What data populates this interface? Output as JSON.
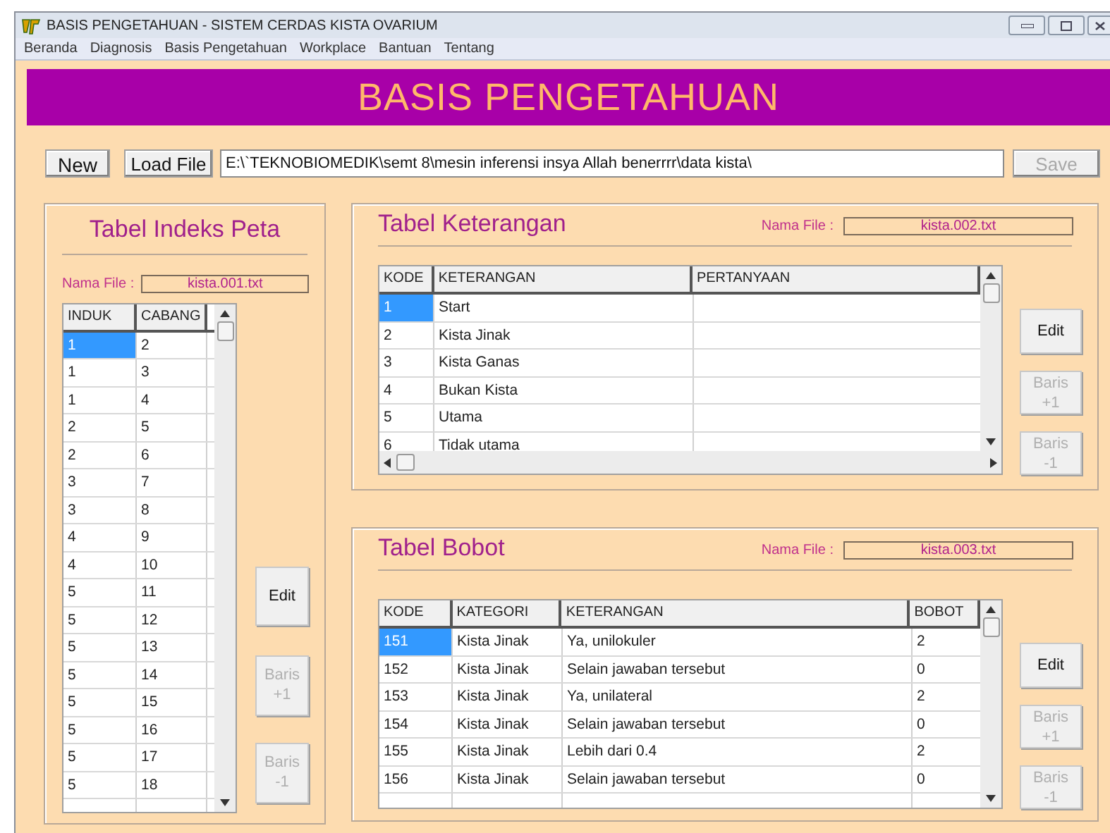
{
  "window": {
    "title": "BASIS PENGETAHUAN - SISTEM CERDAS KISTA OVARIUM"
  },
  "menu": [
    "Beranda",
    "Diagnosis",
    "Basis Pengetahuan",
    "Workplace",
    "Bantuan",
    "Tentang"
  ],
  "banner": "BASIS PENGETAHUAN",
  "toolbar": {
    "buttons": [
      {
        "label": "New",
        "disabled": false
      },
      {
        "label": "Load File",
        "disabled": false
      }
    ],
    "path": "E:\\`TEKNOBIOMEDIK\\semt 8\\mesin inferensi insya Allah benerrrr\\data kista\\",
    "save": {
      "label": "Save",
      "disabled": true
    }
  },
  "panels": [
    {
      "kind": "tall",
      "title": "Tabel Indeks Peta",
      "file_label": "Nama File :",
      "file": "kista.001.txt",
      "columns": [
        "INDUK",
        "CABANG"
      ],
      "rows": [
        {
          "cells": [
            "1",
            "2"
          ],
          "selected": true
        },
        {
          "cells": [
            "1",
            "3"
          ],
          "selected": false
        },
        {
          "cells": [
            "1",
            "4"
          ],
          "selected": false
        },
        {
          "cells": [
            "2",
            "5"
          ],
          "selected": false
        },
        {
          "cells": [
            "2",
            "6"
          ],
          "selected": false
        },
        {
          "cells": [
            "3",
            "7"
          ],
          "selected": false
        },
        {
          "cells": [
            "3",
            "8"
          ],
          "selected": false
        },
        {
          "cells": [
            "4",
            "9"
          ],
          "selected": false
        },
        {
          "cells": [
            "4",
            "10"
          ],
          "selected": false
        },
        {
          "cells": [
            "5",
            "11"
          ],
          "selected": false
        },
        {
          "cells": [
            "5",
            "12"
          ],
          "selected": false
        },
        {
          "cells": [
            "5",
            "13"
          ],
          "selected": false
        },
        {
          "cells": [
            "5",
            "14"
          ],
          "selected": false
        },
        {
          "cells": [
            "5",
            "15"
          ],
          "selected": false
        },
        {
          "cells": [
            "5",
            "16"
          ],
          "selected": false
        },
        {
          "cells": [
            "5",
            "17"
          ],
          "selected": false
        },
        {
          "cells": [
            "5",
            "18"
          ],
          "selected": false
        }
      ],
      "buttons": [
        {
          "label": "Edit",
          "disabled": false
        },
        {
          "label": "Baris +1",
          "disabled": true
        },
        {
          "label": "Baris -1",
          "disabled": true
        }
      ]
    },
    {
      "kind": "wide",
      "title": "Tabel Keterangan",
      "file_label": "Nama File :",
      "file": "kista.002.txt",
      "hscroll": true,
      "columns": [
        "KODE",
        "KETERANGAN",
        "PERTANYAAN"
      ],
      "rows": [
        {
          "cells": [
            "1",
            "Start",
            ""
          ],
          "selected": true
        },
        {
          "cells": [
            "2",
            "Kista Jinak",
            ""
          ],
          "selected": false
        },
        {
          "cells": [
            "3",
            "Kista Ganas",
            ""
          ],
          "selected": false
        },
        {
          "cells": [
            "4",
            "Bukan Kista",
            ""
          ],
          "selected": false
        },
        {
          "cells": [
            "5",
            "Utama",
            ""
          ],
          "selected": false
        },
        {
          "cells": [
            "6",
            "Tidak utama",
            ""
          ],
          "selected": false
        }
      ],
      "buttons": [
        {
          "label": "Edit",
          "disabled": false
        },
        {
          "label": "Baris +1",
          "disabled": true
        },
        {
          "label": "Baris -1",
          "disabled": true
        }
      ]
    },
    {
      "kind": "wide",
      "title": "Tabel Bobot",
      "file_label": "Nama File :",
      "file": "kista.003.txt",
      "columns": [
        "KODE",
        "KATEGORI",
        "KETERANGAN",
        "BOBOT"
      ],
      "rows": [
        {
          "cells": [
            "151",
            "Kista Jinak",
            "Ya, unilokuler",
            "2"
          ],
          "selected": true
        },
        {
          "cells": [
            "152",
            "Kista Jinak",
            "Selain jawaban tersebut",
            "0"
          ],
          "selected": false
        },
        {
          "cells": [
            "153",
            "Kista Jinak",
            "Ya, unilateral",
            "2"
          ],
          "selected": false
        },
        {
          "cells": [
            "154",
            "Kista Jinak",
            "Selain jawaban tersebut",
            "0"
          ],
          "selected": false
        },
        {
          "cells": [
            "155",
            "Kista Jinak",
            "Lebih dari 0.4",
            "2"
          ],
          "selected": false
        },
        {
          "cells": [
            "156",
            "Kista Jinak",
            "Selain jawaban tersebut",
            "0"
          ],
          "selected": false
        }
      ],
      "buttons": [
        {
          "label": "Edit",
          "disabled": false
        },
        {
          "label": "Baris +1",
          "disabled": true
        },
        {
          "label": "Baris -1",
          "disabled": true
        }
      ]
    }
  ]
}
